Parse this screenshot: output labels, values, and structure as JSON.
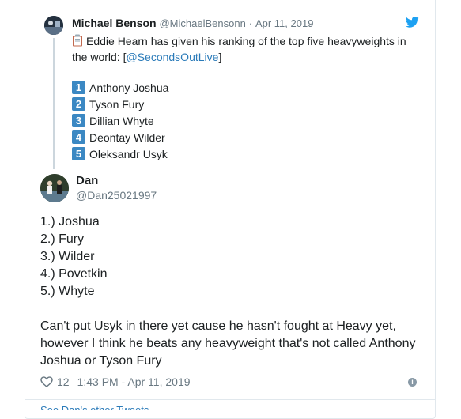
{
  "parent_tweet": {
    "name": "Michael Benson",
    "handle": "@MichaelBensonn",
    "separator": "·",
    "date": "Apr 11, 2019",
    "text_before_link": "Eddie Hearn has given his ranking of the top five heavyweights in the world: [",
    "link": "@SecondsOutLive",
    "text_after_link": "]",
    "rankings": [
      {
        "num": "1",
        "name": "Anthony Joshua"
      },
      {
        "num": "2",
        "name": "Tyson Fury"
      },
      {
        "num": "3",
        "name": "Dillian Whyte"
      },
      {
        "num": "4",
        "name": "Deontay Wilder"
      },
      {
        "num": "5",
        "name": "Oleksandr Usyk"
      }
    ]
  },
  "main_tweet": {
    "name": "Dan",
    "handle": "@Dan25021997",
    "lines": [
      "1.) Joshua",
      "2.) Fury",
      "3.) Wilder",
      "4.) Povetkin",
      "5.) Whyte",
      "",
      "Can't put Usyk in there yet cause he hasn't fought at Heavy yet,",
      "however I think he beats any heavyweight that's not called Anthony",
      "Joshua or Tyson Fury"
    ],
    "likes": "12",
    "timestamp": "1:43 PM - Apr 11, 2019"
  },
  "footer_more": "See Dan's other Tweets",
  "colors": {
    "accent": "#1da1f2",
    "link": "#2b7bb9",
    "muted": "#697882",
    "keycap": "#3b88c3"
  },
  "icons": [
    "twitter-bird-icon",
    "clipboard-icon",
    "heart-icon",
    "info-icon"
  ]
}
